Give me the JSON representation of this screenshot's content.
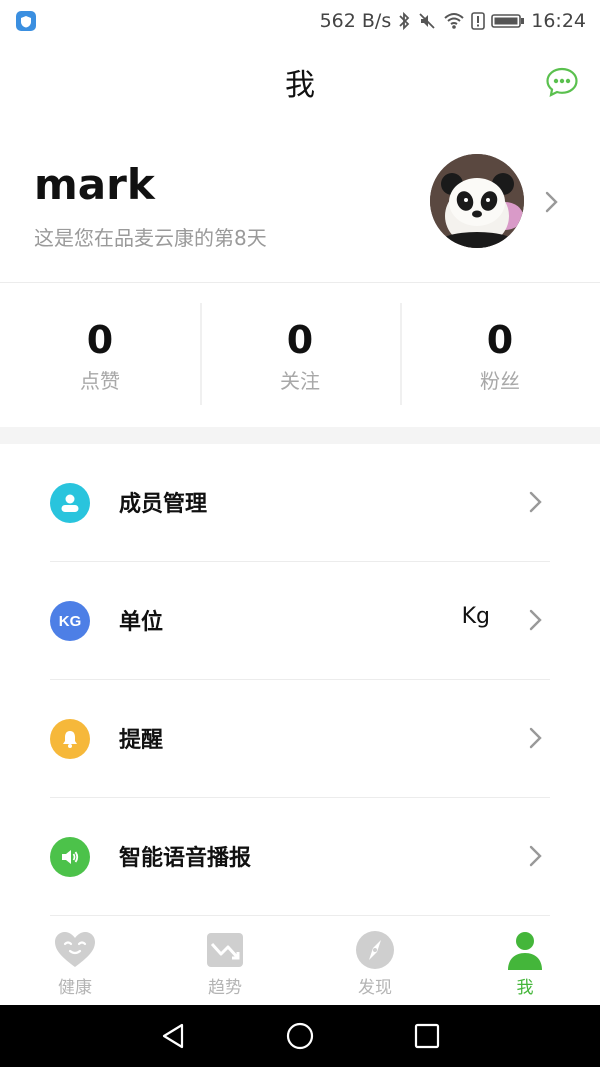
{
  "status_bar": {
    "network_speed": "562 B/s",
    "time": "16:24",
    "icons": [
      "app-shield-icon",
      "bluetooth-icon",
      "mute-icon",
      "wifi-icon",
      "sim-alert-icon",
      "battery-icon"
    ]
  },
  "header": {
    "title": "我",
    "chat_icon": "chat-bubble-icon"
  },
  "profile": {
    "username": "mark",
    "days_text": "这是您在品麦云康的第8天",
    "avatar": "panda-avatar"
  },
  "stats": [
    {
      "value": "0",
      "label": "点赞"
    },
    {
      "value": "0",
      "label": "关注"
    },
    {
      "value": "0",
      "label": "粉丝"
    }
  ],
  "menu": [
    {
      "label": "成员管理",
      "value": "",
      "icon": "member-icon",
      "color": "#29c4dd"
    },
    {
      "label": "单位",
      "value": "Kg",
      "icon": "kg-icon",
      "icon_text": "KG",
      "color": "#4d7fe6"
    },
    {
      "label": "提醒",
      "value": "",
      "icon": "bell-icon",
      "color": "#f6b83a"
    },
    {
      "label": "智能语音播报",
      "value": "",
      "icon": "speaker-icon",
      "color": "#4cc24a"
    }
  ],
  "tabs": [
    {
      "label": "健康",
      "icon": "heart-face-icon",
      "active": false
    },
    {
      "label": "趋势",
      "icon": "trend-chart-icon",
      "active": false
    },
    {
      "label": "发现",
      "icon": "compass-icon",
      "active": false
    },
    {
      "label": "我",
      "icon": "person-icon",
      "active": true
    }
  ],
  "colors": {
    "accent": "#44b63a",
    "inactive_tab": "#c9c9c9",
    "muted_text": "#a8a8a8"
  }
}
